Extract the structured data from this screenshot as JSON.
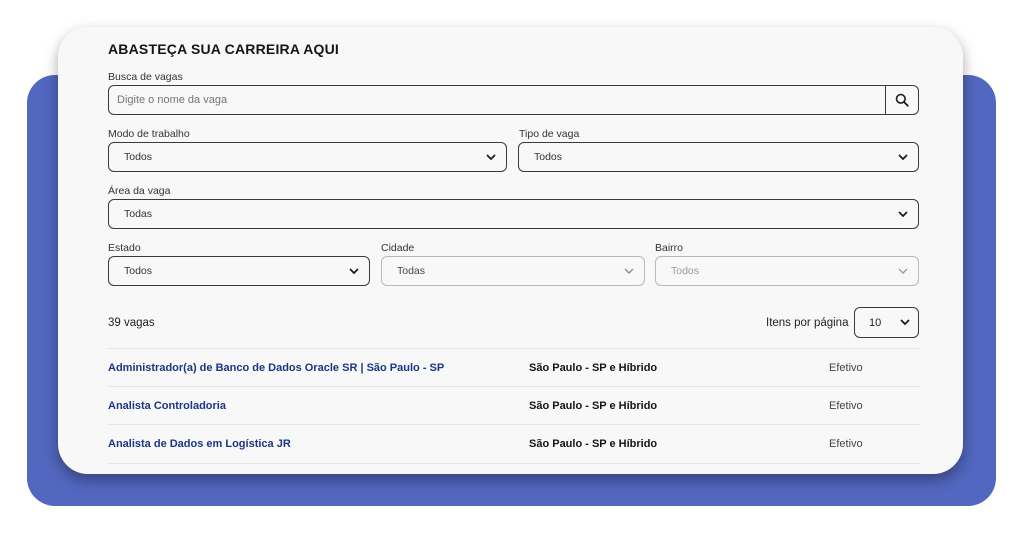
{
  "page": {
    "title": "ABASTEÇA SUA CARREIRA AQUI"
  },
  "search": {
    "label": "Busca de vagas",
    "placeholder": "Digite o nome da vaga",
    "icon": "search-icon"
  },
  "filters": {
    "work_mode": {
      "label": "Modo de trabalho",
      "value": "Todos"
    },
    "job_type": {
      "label": "Tipo de vaga",
      "value": "Todos"
    },
    "area": {
      "label": "Área da vaga",
      "value": "Todas"
    },
    "state": {
      "label": "Estado",
      "value": "Todos"
    },
    "city": {
      "label": "Cidade",
      "value": "Todas"
    },
    "neighborhood": {
      "label": "Bairro",
      "value": "Todos"
    }
  },
  "results": {
    "count": "39 vagas",
    "per_page_label": "Itens por página",
    "per_page_value": "10"
  },
  "jobs": [
    {
      "title": "Administrador(a) de Banco de Dados Oracle SR | São Paulo - SP",
      "location": "São Paulo - SP e Híbrido",
      "type": "Efetivo"
    },
    {
      "title": "Analista Controladoria",
      "location": "São Paulo - SP e Híbrido",
      "type": "Efetivo"
    },
    {
      "title": "Analista de Dados em Logística JR",
      "location": "São Paulo - SP e Híbrido",
      "type": "Efetivo"
    }
  ],
  "colors": {
    "background_slab": "#5267bf",
    "card": "#f8f8f8",
    "job_link": "#1b3683"
  }
}
